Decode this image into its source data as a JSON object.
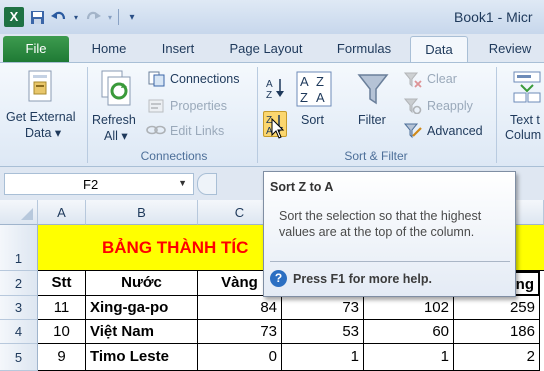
{
  "window": {
    "title": "Book1 - Micr",
    "logo": "X"
  },
  "qat": {
    "save": "save-icon",
    "undo": "undo-icon",
    "redo": "redo-icon",
    "customize": "customize-icon"
  },
  "tabs": [
    {
      "label": "File"
    },
    {
      "label": "Home"
    },
    {
      "label": "Insert"
    },
    {
      "label": "Page Layout"
    },
    {
      "label": "Formulas"
    },
    {
      "label": "Data"
    },
    {
      "label": "Review"
    }
  ],
  "ribbon": {
    "get_external": {
      "line1": "Get External",
      "line2": "Data ▾"
    },
    "refresh": {
      "line1": "Refresh",
      "line2": "All ▾"
    },
    "connections": "Connections",
    "properties": "Properties",
    "edit_links": "Edit Links",
    "connections_group": "Connections",
    "sort": "Sort",
    "filter": "Filter",
    "clear": "Clear",
    "reapply": "Reapply",
    "advanced": "Advanced",
    "sort_filter_group": "Sort & Filter",
    "text_to_columns": {
      "line1": "Text t",
      "line2": "Colum"
    }
  },
  "namebox": {
    "value": "F2",
    "arrow": "▼"
  },
  "columns": [
    "A",
    "B",
    "C"
  ],
  "rows": [
    "1",
    "2",
    "3",
    "4",
    "5"
  ],
  "sheet": {
    "title": "BẢNG THÀNH TÍC",
    "headers": {
      "stt": "Stt",
      "country": "Nước",
      "gold": "Vàng",
      "total": "ổng"
    },
    "data": [
      {
        "stt": "11",
        "country": "Xing-ga-po",
        "gold": "84",
        "silver": "73",
        "bronze": "102",
        "total": "259"
      },
      {
        "stt": "10",
        "country": "Việt Nam",
        "gold": "73",
        "silver": "53",
        "bronze": "60",
        "total": "186"
      },
      {
        "stt": "9",
        "country": "Timo Leste",
        "gold": "0",
        "silver": "1",
        "bronze": "1",
        "total": "2"
      }
    ]
  },
  "tooltip": {
    "title": "Sort Z to A",
    "body": "Sort the selection so that the highest values are at the top of the column.",
    "help": "Press F1 for more help.",
    "help_icon": "?"
  },
  "colors": {
    "title_red": "#ff0000",
    "title_bg": "#ffff00",
    "file_tab": "#1f7a35"
  }
}
